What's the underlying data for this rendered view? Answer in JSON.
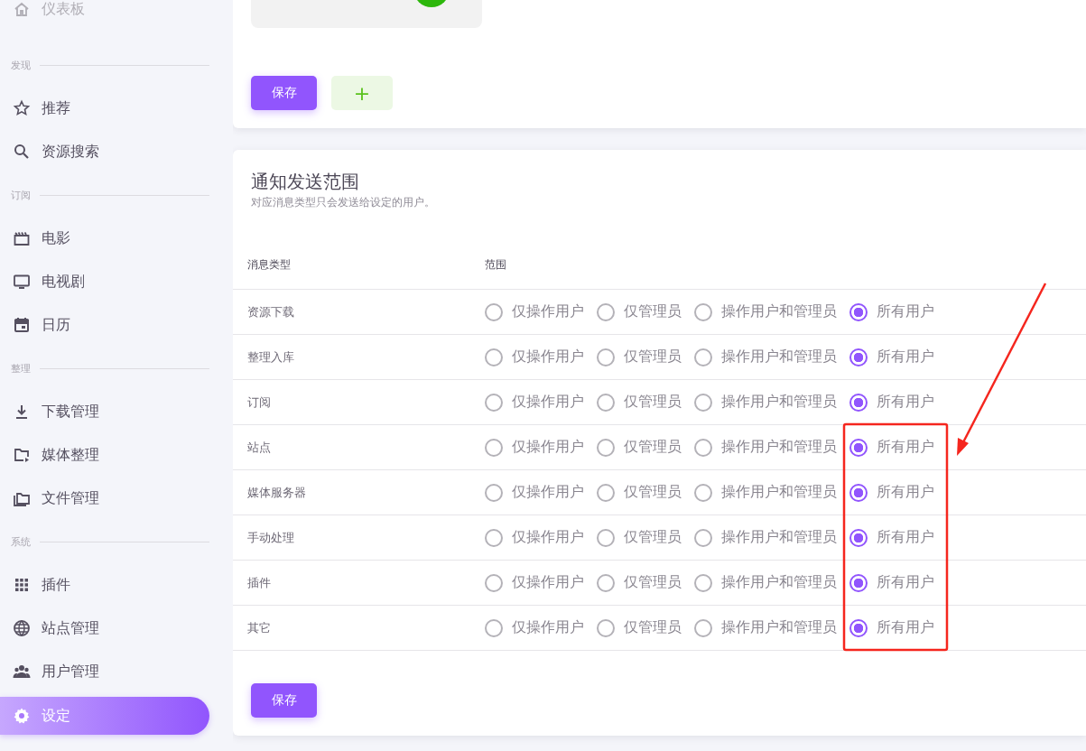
{
  "sidebar": {
    "items": [
      {
        "kind": "item",
        "label": "仪表板",
        "selected": false
      },
      {
        "kind": "section",
        "label": "发现"
      },
      {
        "kind": "item",
        "label": "推荐",
        "selected": false
      },
      {
        "kind": "item",
        "label": "资源搜索",
        "selected": false
      },
      {
        "kind": "section",
        "label": "订阅"
      },
      {
        "kind": "item",
        "label": "电影",
        "selected": false
      },
      {
        "kind": "item",
        "label": "电视剧",
        "selected": false
      },
      {
        "kind": "item",
        "label": "日历",
        "selected": false
      },
      {
        "kind": "section",
        "label": "整理"
      },
      {
        "kind": "item",
        "label": "下载管理",
        "selected": false
      },
      {
        "kind": "item",
        "label": "媒体整理",
        "selected": false
      },
      {
        "kind": "item",
        "label": "文件管理",
        "selected": false
      },
      {
        "kind": "section",
        "label": "系统"
      },
      {
        "kind": "item",
        "label": "插件",
        "selected": false
      },
      {
        "kind": "item",
        "label": "站点管理",
        "selected": false
      },
      {
        "kind": "item",
        "label": "用户管理",
        "selected": false
      },
      {
        "kind": "item",
        "label": "设定",
        "selected": true
      }
    ]
  },
  "top_card": {
    "save_button": "保存",
    "add_button": "+"
  },
  "scope_card": {
    "title": "通知发送范围",
    "subtitle": "对应消息类型只会发送给设定的用户。",
    "columns": [
      "消息类型",
      "范围"
    ],
    "rows": [
      {
        "type": "资源下载",
        "options": [
          {
            "label": "仅操作用户",
            "selected": false
          },
          {
            "label": "仅管理员",
            "selected": false
          },
          {
            "label": "操作用户和管理员",
            "selected": false
          },
          {
            "label": "所有用户",
            "selected": true
          }
        ]
      },
      {
        "type": "整理入库",
        "options": [
          {
            "label": "仅操作用户",
            "selected": false
          },
          {
            "label": "仅管理员",
            "selected": false
          },
          {
            "label": "操作用户和管理员",
            "selected": false
          },
          {
            "label": "所有用户",
            "selected": true
          }
        ]
      },
      {
        "type": "订阅",
        "options": [
          {
            "label": "仅操作用户",
            "selected": false
          },
          {
            "label": "仅管理员",
            "selected": false
          },
          {
            "label": "操作用户和管理员",
            "selected": false
          },
          {
            "label": "所有用户",
            "selected": true
          }
        ]
      },
      {
        "type": "站点",
        "options": [
          {
            "label": "仅操作用户",
            "selected": false
          },
          {
            "label": "仅管理员",
            "selected": false
          },
          {
            "label": "操作用户和管理员",
            "selected": false
          },
          {
            "label": "所有用户",
            "selected": true
          }
        ]
      },
      {
        "type": "媒体服务器",
        "options": [
          {
            "label": "仅操作用户",
            "selected": false
          },
          {
            "label": "仅管理员",
            "selected": false
          },
          {
            "label": "操作用户和管理员",
            "selected": false
          },
          {
            "label": "所有用户",
            "selected": true
          }
        ]
      },
      {
        "type": "手动处理",
        "options": [
          {
            "label": "仅操作用户",
            "selected": false
          },
          {
            "label": "仅管理员",
            "selected": false
          },
          {
            "label": "操作用户和管理员",
            "selected": false
          },
          {
            "label": "所有用户",
            "selected": true
          }
        ]
      },
      {
        "type": "插件",
        "options": [
          {
            "label": "仅操作用户",
            "selected": false
          },
          {
            "label": "仅管理员",
            "selected": false
          },
          {
            "label": "操作用户和管理员",
            "selected": false
          },
          {
            "label": "所有用户",
            "selected": true
          }
        ]
      },
      {
        "type": "其它",
        "options": [
          {
            "label": "仅操作用户",
            "selected": false
          },
          {
            "label": "仅管理员",
            "selected": false
          },
          {
            "label": "操作用户和管理员",
            "selected": false
          },
          {
            "label": "所有用户",
            "selected": true
          }
        ]
      }
    ],
    "save_button": "保存"
  },
  "annotations": [
    {
      "kind": "box-with-arrow"
    }
  ]
}
